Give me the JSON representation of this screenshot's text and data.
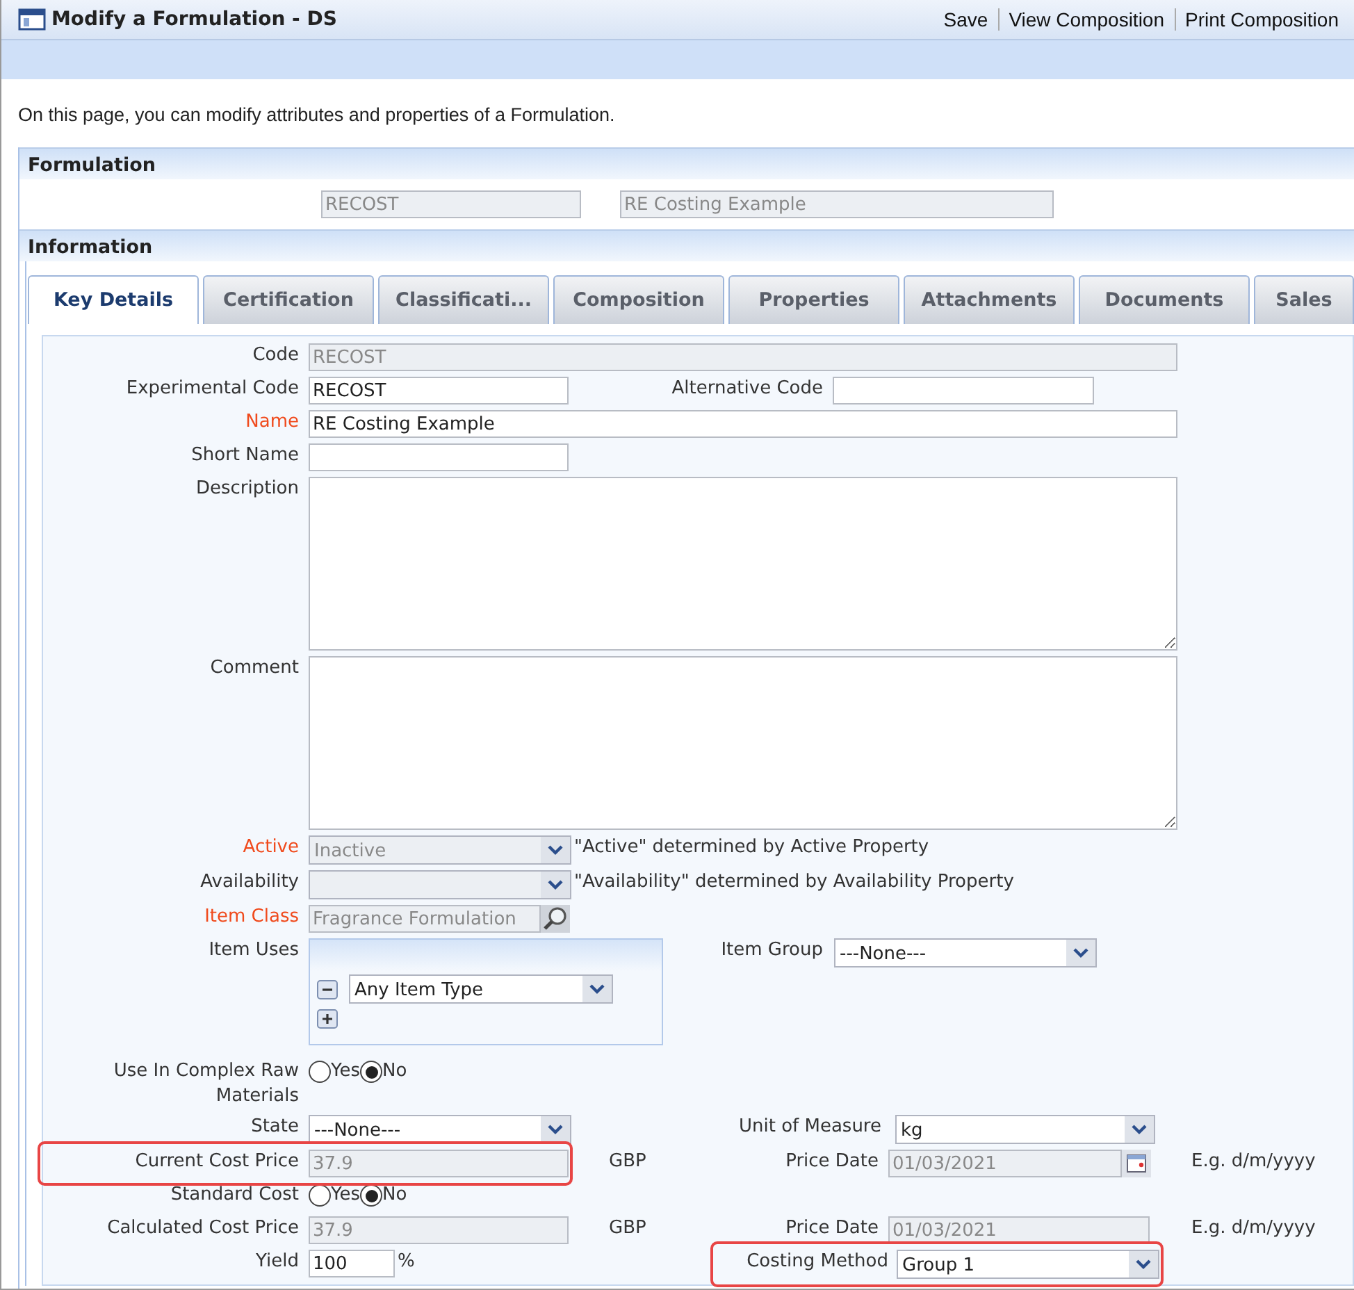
{
  "window": {
    "title": "Modify a Formulation - DS"
  },
  "toolbar": [
    {
      "label": "Save"
    },
    {
      "label": "View Composition"
    },
    {
      "label": "Print Composition"
    }
  ],
  "intro": "On this page, you can modify attributes and properties of a Formulation.",
  "formulation": {
    "title": "Formulation",
    "code": {
      "value": "RECOST",
      "disabled": true
    },
    "name": {
      "value": "RE Costing Example",
      "disabled": true
    }
  },
  "information": {
    "title": "Information"
  },
  "tabs": [
    {
      "label": "Key Details",
      "selected": true
    },
    {
      "label": "Certification",
      "selected": false
    },
    {
      "label": "Classificati...",
      "selected": false
    },
    {
      "label": "Composition",
      "selected": false
    },
    {
      "label": "Properties",
      "selected": false
    },
    {
      "label": "Attachments",
      "selected": false
    },
    {
      "label": "Documents",
      "selected": false
    },
    {
      "label": "Sales",
      "selected": false
    }
  ],
  "rows": [
    {
      "label": "Code",
      "required": false,
      "highlighted": false,
      "items": [
        {
          "kind": "text",
          "value": "RECOST",
          "disabled": true
        }
      ]
    },
    {
      "label": "Experimental Code",
      "required": false,
      "highlighted": false,
      "items": [
        {
          "kind": "text",
          "value": "RECOST",
          "disabled": false
        },
        {
          "kind": "label",
          "text": "Alternative Code",
          "highlighted": false
        },
        {
          "kind": "text",
          "value": "",
          "disabled": false
        }
      ]
    },
    {
      "label": "Name",
      "required": true,
      "highlighted": false,
      "items": [
        {
          "kind": "text",
          "value": "RE Costing Example",
          "disabled": false
        }
      ]
    },
    {
      "label": "Short Name",
      "required": false,
      "highlighted": false,
      "items": [
        {
          "kind": "text",
          "value": "",
          "disabled": false
        }
      ]
    },
    {
      "label": "Description",
      "required": false,
      "highlighted": false,
      "items": [
        {
          "kind": "textarea",
          "value": ""
        }
      ]
    },
    {
      "label": "Comment",
      "required": false,
      "highlighted": false,
      "items": [
        {
          "kind": "textarea",
          "value": ""
        }
      ]
    },
    {
      "label": "Active",
      "required": true,
      "highlighted": false,
      "items": [
        {
          "kind": "select",
          "value": "Inactive",
          "disabled": true
        },
        {
          "kind": "note",
          "text": "\"Active\" determined by Active Property"
        }
      ]
    },
    {
      "label": "Availability",
      "required": false,
      "highlighted": false,
      "items": [
        {
          "kind": "select",
          "value": "",
          "disabled": true
        },
        {
          "kind": "note",
          "text": "\"Availability\" determined by Availability Property"
        }
      ]
    },
    {
      "label": "Item Class",
      "required": true,
      "highlighted": false,
      "items": [
        {
          "kind": "lookup",
          "value": "Fragrance Formulation",
          "disabled": true
        }
      ]
    },
    {
      "label": "Item Uses",
      "required": false,
      "highlighted": false,
      "items": [
        {
          "kind": "itemuses",
          "value": "Any Item Type"
        },
        {
          "kind": "label",
          "text": "Item Group",
          "highlighted": false
        },
        {
          "kind": "select",
          "value": "---None---",
          "disabled": false
        }
      ]
    },
    {
      "label": "Use In Complex Raw Materials",
      "required": false,
      "highlighted": false,
      "items": [
        {
          "kind": "radio",
          "options": [
            {
              "label": "Yes",
              "selected": false
            },
            {
              "label": "No",
              "selected": true
            }
          ]
        }
      ]
    },
    {
      "label": "State",
      "required": false,
      "highlighted": false,
      "items": [
        {
          "kind": "select",
          "value": "---None---",
          "disabled": false
        },
        {
          "kind": "label",
          "text": "Unit of Measure",
          "highlighted": false
        },
        {
          "kind": "select",
          "value": "kg",
          "disabled": false
        }
      ]
    },
    {
      "label": "Current Cost Price",
      "required": false,
      "highlighted": true,
      "items": [
        {
          "kind": "text",
          "value": "37.9",
          "disabled": true
        },
        {
          "kind": "unit",
          "text": "GBP"
        },
        {
          "kind": "label",
          "text": "Price Date",
          "highlighted": false
        },
        {
          "kind": "date",
          "value": "01/03/2021",
          "disabled": true
        },
        {
          "kind": "hint",
          "text": "E.g. d/m/yyyy"
        }
      ]
    },
    {
      "label": "Standard Cost",
      "required": false,
      "highlighted": false,
      "items": [
        {
          "kind": "radio",
          "options": [
            {
              "label": "Yes",
              "selected": false
            },
            {
              "label": "No",
              "selected": true
            }
          ]
        }
      ]
    },
    {
      "label": "Calculated Cost Price",
      "required": false,
      "highlighted": false,
      "items": [
        {
          "kind": "text",
          "value": "37.9",
          "disabled": true
        },
        {
          "kind": "unit",
          "text": "GBP"
        },
        {
          "kind": "label",
          "text": "Price Date",
          "highlighted": false
        },
        {
          "kind": "text",
          "value": "01/03/2021",
          "disabled": true
        },
        {
          "kind": "hint",
          "text": "E.g. d/m/yyyy"
        }
      ]
    },
    {
      "label": "Yield",
      "required": false,
      "highlighted": false,
      "items": [
        {
          "kind": "text",
          "value": "100",
          "disabled": false
        },
        {
          "kind": "unit",
          "text": "%"
        },
        {
          "kind": "label",
          "text": "Costing Method",
          "highlighted": true
        },
        {
          "kind": "select",
          "value": "Group 1",
          "disabled": false
        }
      ]
    }
  ]
}
